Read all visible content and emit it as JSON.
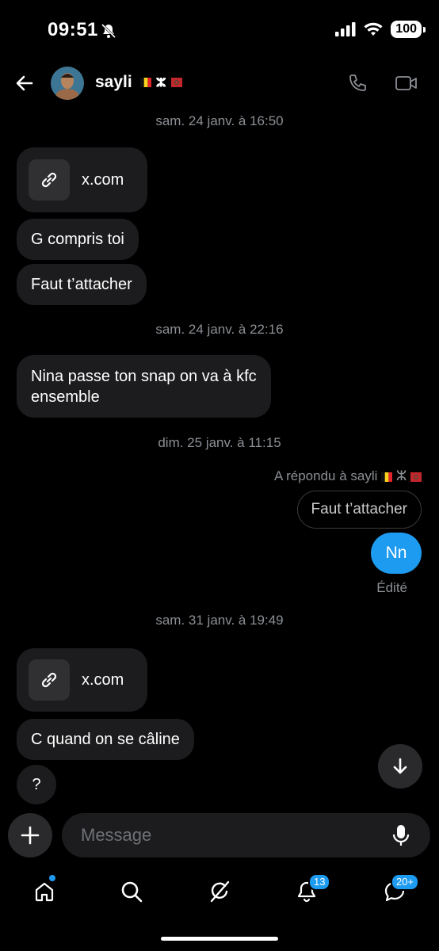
{
  "status": {
    "time": "09:51",
    "battery": "100"
  },
  "header": {
    "name": "sayli",
    "flag_chars": "ⵣ"
  },
  "messages": {
    "date1": "sam. 24 janv. à 16:50",
    "link1": "x.com",
    "m1": "G compris toi",
    "m2": "Faut t’attacher",
    "date2": "sam. 24 janv. à 22:16",
    "m3_line1": "Nina passe ton snap on va à kfc",
    "m3_line2": "ensemble",
    "date3": "dim. 25 janv. à 11:15",
    "reply_info": "A répondu à sayli",
    "reply_quote": "Faut t’attacher",
    "out1": "Nn",
    "edited": "Édité",
    "date4": "sam. 31 janv. à 19:49",
    "link2": "x.com",
    "m4": "C quand on se câline",
    "m5": "?"
  },
  "composer": {
    "placeholder": "Message"
  },
  "nav": {
    "notif_badge": "13",
    "msg_badge": "20+"
  },
  "colors": {
    "accent": "#1d9bf0",
    "bubble": "#1c1c1e",
    "muted": "#8b8f94"
  }
}
